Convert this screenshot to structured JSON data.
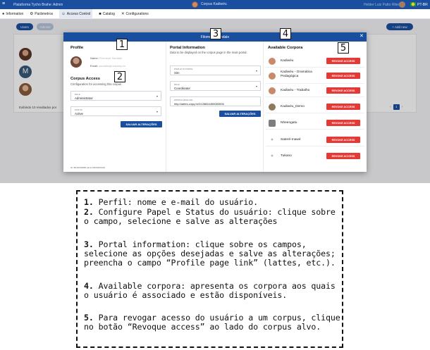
{
  "topbar": {
    "menu_icon": "hamburger-icon",
    "app_title": "Plataforma Tycho Brahe: Admin",
    "corpus_name": "Corpus Kadiwéu",
    "user_name": "Helder Luiz Patto Ribeiro",
    "language": "PT-BR"
  },
  "nav": {
    "items": [
      {
        "label": "Information",
        "icon": "info-icon"
      },
      {
        "label": "Parâmetros",
        "icon": "settings-icon"
      },
      {
        "label": "Access Control",
        "icon": "people-icon"
      },
      {
        "label": "Catalog",
        "icon": "book-icon"
      },
      {
        "label": "Configurations",
        "icon": "tools-icon"
      }
    ]
  },
  "subtoolbar": {
    "users_label": "Users",
    "admin_label": "Admins",
    "add_new_label": "+ Add new"
  },
  "list": {
    "pager_text": "Exibindo 10 resultados por",
    "page": "1"
  },
  "modal": {
    "title": "Filomena Sandalo",
    "close_icon": "close-icon",
    "profile": {
      "title": "Profile",
      "name_label": "Name:",
      "name_value": "Filomena Sandalo",
      "email_label": "Email:",
      "email_value": "sandalo@unicamp.br"
    },
    "corpus_access": {
      "title": "Corpus Access",
      "subtitle": "Configuration for accessing this corpus",
      "role_label": "ROLE",
      "role_value": "Administrator",
      "status_label": "STATUS",
      "status_value": "Active",
      "save_label": "SALVAR ALTERAÇÕES"
    },
    "portal_info": {
      "title": "Portal Information",
      "subtitle": "Data to be displayed on the corpus page in the main portal.",
      "display_label": "DISPLAY IN PORTAL",
      "display_value": "Sim",
      "role_label": "ROLE",
      "role_value": "Coordinator",
      "link_label": "PROFILE PAGE URL",
      "link_value": "http://lattes.cnpq.br/3128654459083006",
      "save_label": "SALVAR ALTERAÇÕES"
    },
    "available_corpora": {
      "title": "Available Corpora",
      "revoke_label": "REVOKE ACCESS",
      "items": [
        {
          "name": "Kadiwéu"
        },
        {
          "name": "Kadiwéu - Gramática Pedagógica"
        },
        {
          "name": "Kadiwéu - Trabalho"
        },
        {
          "name": "Kadiwéu_Demo"
        },
        {
          "name": "Nheengatu"
        },
        {
          "name": "Sateré-mawé"
        },
        {
          "name": "Tukano"
        }
      ]
    },
    "footer": "ID: 5fb1bf4f4f08f0 admin PROFESSOR"
  },
  "callouts": [
    "1",
    "2",
    "3",
    "4",
    "5"
  ],
  "instructions": [
    {
      "num": "1.",
      "text": " Perfil: nome e e-mail do usuário."
    },
    {
      "num": "2.",
      "text": " Configure Papel e Status do usuário: clique sobre o campo, selecione e salve as alterações"
    },
    {
      "num": "3.",
      "text": " Portal information: clique sobre os campos, selecione as opções desejadas e salve as alterações; preencha o campo “Profile page link” (lattes, etc.)."
    },
    {
      "num": "4.",
      "text": " Available corpora: apresenta os corpora aos quais o usuário é associado e estão disponíveis."
    },
    {
      "num": "5.",
      "text": " Para revogar acesso do usuário a um corpus, clique no botão “Revoque access” ao lado do corpus alvo."
    }
  ],
  "colors": {
    "primary": "#1a4fa0",
    "revoke": "#e53935"
  }
}
